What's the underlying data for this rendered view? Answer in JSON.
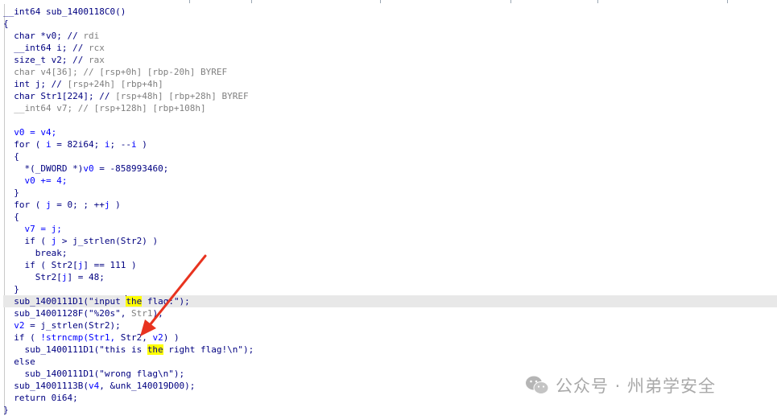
{
  "colors": {
    "navy": "#000080",
    "gray": "#808080",
    "blue": "#0000ff",
    "black": "#000000",
    "green": "#008000",
    "highlight": "#ffff00",
    "current_line": "#e8e8e8",
    "arrow": "#e8331f",
    "watermark": "#a9a9a9"
  },
  "code": {
    "lines": [
      {
        "id": "L0",
        "tokens": [
          {
            "t": "__int64 sub_1400118C0()",
            "c": "navy"
          }
        ]
      },
      {
        "id": "L1",
        "tokens": [
          {
            "t": "{",
            "c": "navy"
          }
        ]
      },
      {
        "id": "L2",
        "tokens": [
          {
            "t": "  char *v0; // ",
            "c": "navy"
          },
          {
            "t": "rdi",
            "c": "gray"
          }
        ]
      },
      {
        "id": "L3",
        "tokens": [
          {
            "t": "  __int64 i; // ",
            "c": "navy"
          },
          {
            "t": "rcx",
            "c": "gray"
          }
        ]
      },
      {
        "id": "L4",
        "tokens": [
          {
            "t": "  size_t v2; // ",
            "c": "navy"
          },
          {
            "t": "rax",
            "c": "gray"
          }
        ]
      },
      {
        "id": "L5",
        "tokens": [
          {
            "t": "  char v4[36]; // [rsp+0h] [rbp-20h] BYREF",
            "c": "gray"
          }
        ]
      },
      {
        "id": "L6",
        "tokens": [
          {
            "t": "  int j; // ",
            "c": "navy"
          },
          {
            "t": "[rsp+24h] [rbp+4h]",
            "c": "gray"
          }
        ]
      },
      {
        "id": "L7",
        "tokens": [
          {
            "t": "  char Str1[224]; // ",
            "c": "navy"
          },
          {
            "t": "[rsp+48h] [rbp+28h] BYREF",
            "c": "gray"
          }
        ]
      },
      {
        "id": "L8",
        "tokens": [
          {
            "t": "  __int64 v7; // [rsp+128h] [rbp+108h]",
            "c": "gray"
          }
        ]
      },
      {
        "id": "L9",
        "tokens": [
          {
            "t": "",
            "c": "navy"
          }
        ]
      },
      {
        "id": "L10",
        "tokens": [
          {
            "t": "  v0 = v4;",
            "c": "blue"
          }
        ]
      },
      {
        "id": "L11",
        "tokens": [
          {
            "t": "  for ( ",
            "c": "navy"
          },
          {
            "t": "i",
            "c": "blue"
          },
          {
            "t": " = 82i64; ",
            "c": "navy"
          },
          {
            "t": "i",
            "c": "blue"
          },
          {
            "t": "; --",
            "c": "navy"
          },
          {
            "t": "i",
            "c": "blue"
          },
          {
            "t": " )",
            "c": "navy"
          }
        ]
      },
      {
        "id": "L12",
        "tokens": [
          {
            "t": "  {",
            "c": "navy"
          }
        ]
      },
      {
        "id": "L13",
        "tokens": [
          {
            "t": "    *(_DWORD *)",
            "c": "navy"
          },
          {
            "t": "v0",
            "c": "blue"
          },
          {
            "t": " = -858993460;",
            "c": "navy"
          }
        ]
      },
      {
        "id": "L14",
        "tokens": [
          {
            "t": "    v0 += 4;",
            "c": "blue"
          }
        ]
      },
      {
        "id": "L15",
        "tokens": [
          {
            "t": "  }",
            "c": "navy"
          }
        ]
      },
      {
        "id": "L16",
        "tokens": [
          {
            "t": "  for ( ",
            "c": "navy"
          },
          {
            "t": "j",
            "c": "blue"
          },
          {
            "t": " = 0; ; ++",
            "c": "navy"
          },
          {
            "t": "j",
            "c": "blue"
          },
          {
            "t": " )",
            "c": "navy"
          }
        ]
      },
      {
        "id": "L17",
        "tokens": [
          {
            "t": "  {",
            "c": "navy"
          }
        ]
      },
      {
        "id": "L18",
        "tokens": [
          {
            "t": "    v7 = j;",
            "c": "blue"
          }
        ]
      },
      {
        "id": "L19",
        "tokens": [
          {
            "t": "    if ( ",
            "c": "navy"
          },
          {
            "t": "j",
            "c": "blue"
          },
          {
            "t": " > j_strlen(Str2) )",
            "c": "navy"
          }
        ]
      },
      {
        "id": "L20",
        "tokens": [
          {
            "t": "      break;",
            "c": "navy"
          }
        ]
      },
      {
        "id": "L21",
        "tokens": [
          {
            "t": "    if ( Str2[",
            "c": "navy"
          },
          {
            "t": "j",
            "c": "blue"
          },
          {
            "t": "] == 111 )",
            "c": "navy"
          }
        ]
      },
      {
        "id": "L22",
        "tokens": [
          {
            "t": "      Str2[",
            "c": "navy"
          },
          {
            "t": "j",
            "c": "blue"
          },
          {
            "t": "] = 48;",
            "c": "navy"
          }
        ]
      },
      {
        "id": "L23",
        "tokens": [
          {
            "t": "  }",
            "c": "navy"
          }
        ]
      },
      {
        "id": "L24",
        "current": true,
        "tokens": [
          {
            "t": "  sub_1400111D1(\"input ",
            "c": "navy"
          },
          {
            "t": "",
            "c": "cursor"
          },
          {
            "t": "the",
            "c": "navy",
            "hl": true
          },
          {
            "t": " flag:\");",
            "c": "navy"
          }
        ]
      },
      {
        "id": "L25",
        "tokens": [
          {
            "t": "  sub_14001128F(\"%20s\", ",
            "c": "navy"
          },
          {
            "t": "Str1",
            "c": "gray"
          },
          {
            "t": ");",
            "c": "navy"
          }
        ]
      },
      {
        "id": "L26",
        "tokens": [
          {
            "t": "  v2",
            "c": "blue"
          },
          {
            "t": " = j_strlen(Str2);",
            "c": "navy"
          }
        ]
      },
      {
        "id": "L27",
        "tokens": [
          {
            "t": "  if ( ",
            "c": "navy"
          },
          {
            "t": "!strncmp(Str1, ",
            "c": "blue"
          },
          {
            "t": "Str2, ",
            "c": "navy"
          },
          {
            "t": "v2",
            "c": "blue"
          },
          {
            "t": ") )",
            "c": "navy"
          }
        ]
      },
      {
        "id": "L28",
        "tokens": [
          {
            "t": "    sub_1400111D1(\"this is ",
            "c": "navy"
          },
          {
            "t": "the",
            "c": "navy",
            "hl": true
          },
          {
            "t": " right flag!\\n\");",
            "c": "navy"
          }
        ]
      },
      {
        "id": "L29",
        "tokens": [
          {
            "t": "  else",
            "c": "navy"
          }
        ]
      },
      {
        "id": "L30",
        "tokens": [
          {
            "t": "    sub_1400111D1(\"wrong flag\\n\");",
            "c": "navy"
          }
        ]
      },
      {
        "id": "L31",
        "tokens": [
          {
            "t": "  sub_14001113B(",
            "c": "navy"
          },
          {
            "t": "v4",
            "c": "blue"
          },
          {
            "t": ", &unk_140019D00);",
            "c": "navy"
          }
        ]
      },
      {
        "id": "L32",
        "tokens": [
          {
            "t": "  return 0i64;",
            "c": "navy"
          }
        ]
      },
      {
        "id": "L33",
        "tokens": [
          {
            "t": "}",
            "c": "navy"
          }
        ]
      }
    ]
  },
  "watermark": {
    "icon": "wechat-icon",
    "text": "公众号 · 州弟学安全"
  }
}
